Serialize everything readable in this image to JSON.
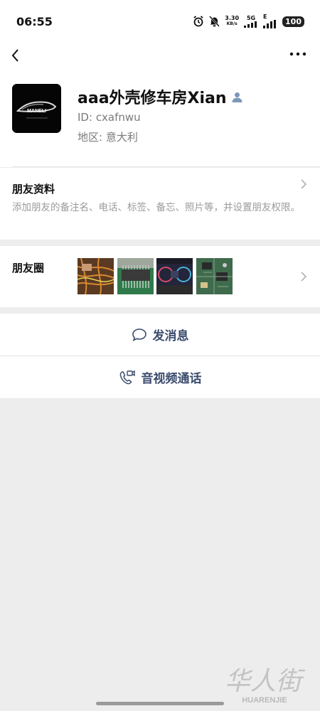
{
  "status_bar": {
    "time": "06:55",
    "speed_value": "3.30",
    "speed_unit": "KB/s",
    "network": "5G",
    "network_e": "E",
    "battery": "100",
    "icons": [
      "alarm-icon",
      "mute-icon",
      "signal-icon",
      "battery-icon"
    ]
  },
  "nav": {
    "back_icon": "chevron-left-icon",
    "more_icon": "more-icon"
  },
  "profile": {
    "name": "aaa外壳修车房Xian",
    "id_label": "ID:",
    "id_value": "cxafnwu",
    "region_label": "地区:",
    "region_value": "意大利",
    "avatar_logo_text": "MANELI"
  },
  "friend_info": {
    "title": "朋友资料",
    "description": "添加朋友的备注名、电话、标签、备忘、照片等，并设置朋友权限。"
  },
  "moments": {
    "title": "朋友圈",
    "thumbnails": [
      "wiring-photo",
      "connector-photo",
      "dashboard-photo",
      "circuit-board-photo"
    ]
  },
  "actions": {
    "message_label": "发消息",
    "call_label": "音视频通话"
  },
  "watermark": {
    "text": "华人街",
    "sub": "HUARENJIE"
  },
  "colors": {
    "action_text": "#3a4b6c",
    "background": "#ededed",
    "description": "#9a9a9a"
  }
}
